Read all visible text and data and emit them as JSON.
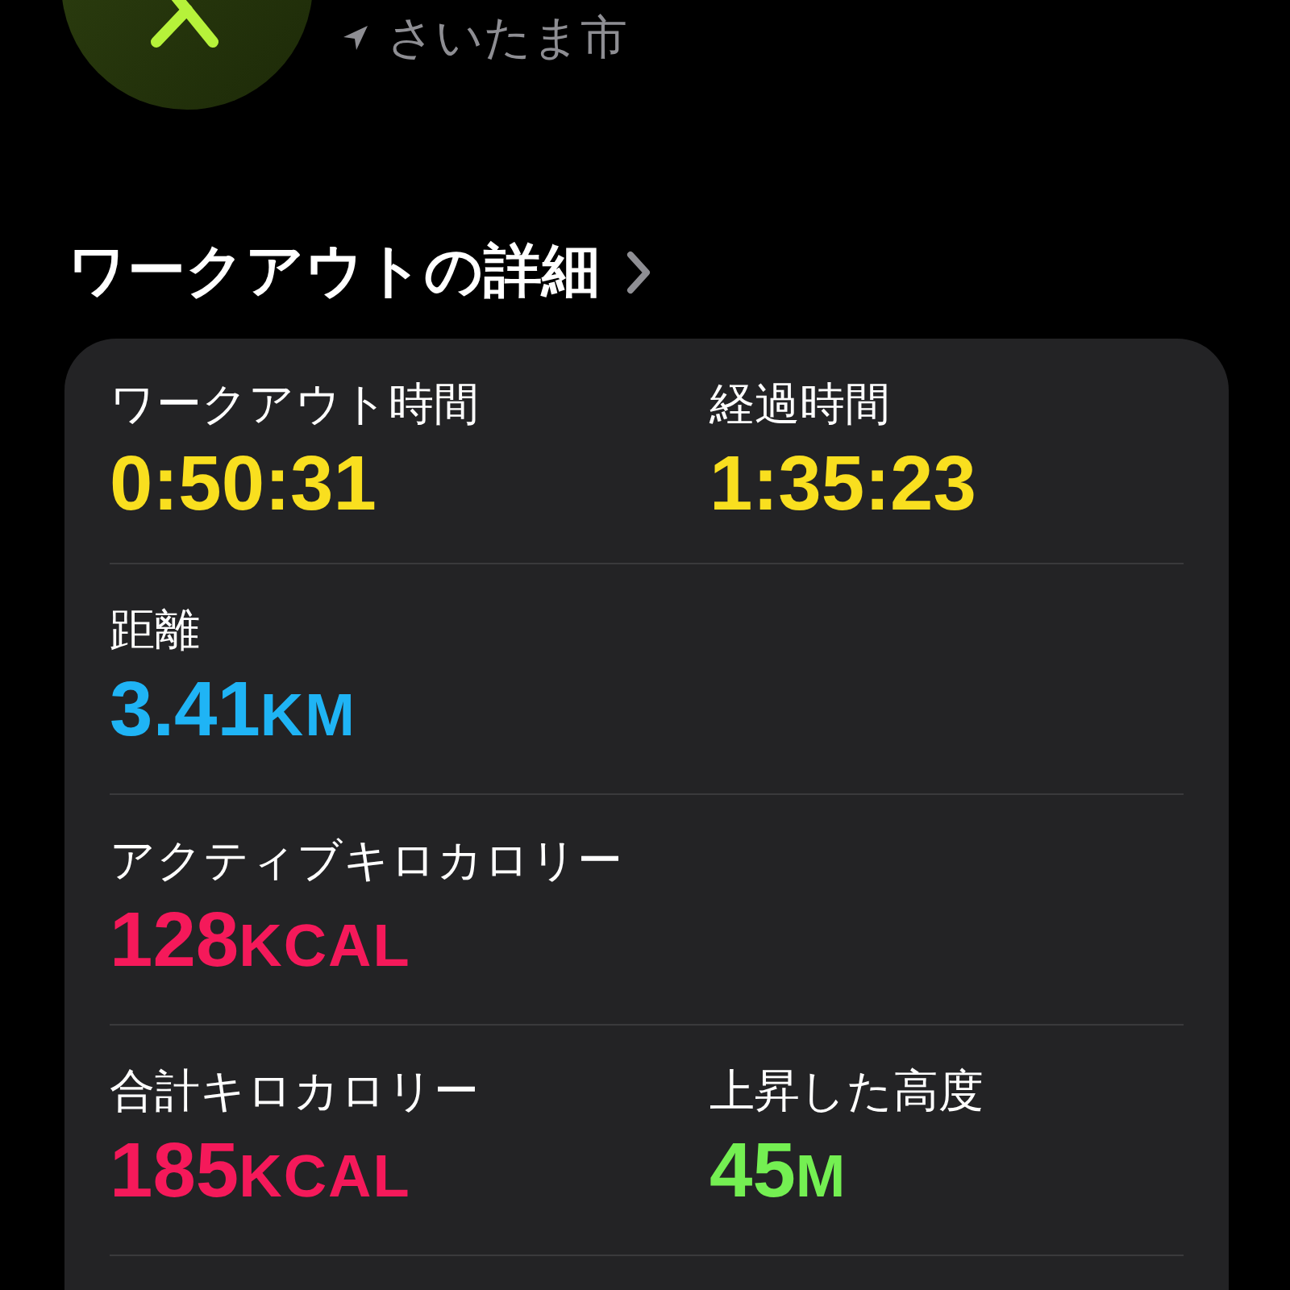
{
  "header": {
    "location": "さいたま市"
  },
  "details": {
    "title": "ワークアウトの詳細"
  },
  "metric_rows": [
    {
      "items": [
        {
          "label": "ワークアウト時間",
          "value": "0:50:31",
          "color": "#f9df1f"
        },
        {
          "label": "経過時間",
          "value": "1:35:23",
          "color": "#f9df1f"
        }
      ]
    },
    {
      "items": [
        {
          "label": "距離",
          "value": "3.41",
          "unit": "KM",
          "color": "#1fb4f5"
        }
      ]
    },
    {
      "items": [
        {
          "label": "アクティブキロカロリー",
          "value": "128",
          "unit": "KCAL",
          "color": "#f5195a"
        }
      ]
    },
    {
      "items": [
        {
          "label": "合計キロカロリー",
          "value": "185",
          "unit": "KCAL",
          "color": "#f5195a"
        },
        {
          "label": "上昇した高度",
          "value": "45",
          "unit": "M",
          "color": "#74ef52"
        }
      ]
    }
  ]
}
